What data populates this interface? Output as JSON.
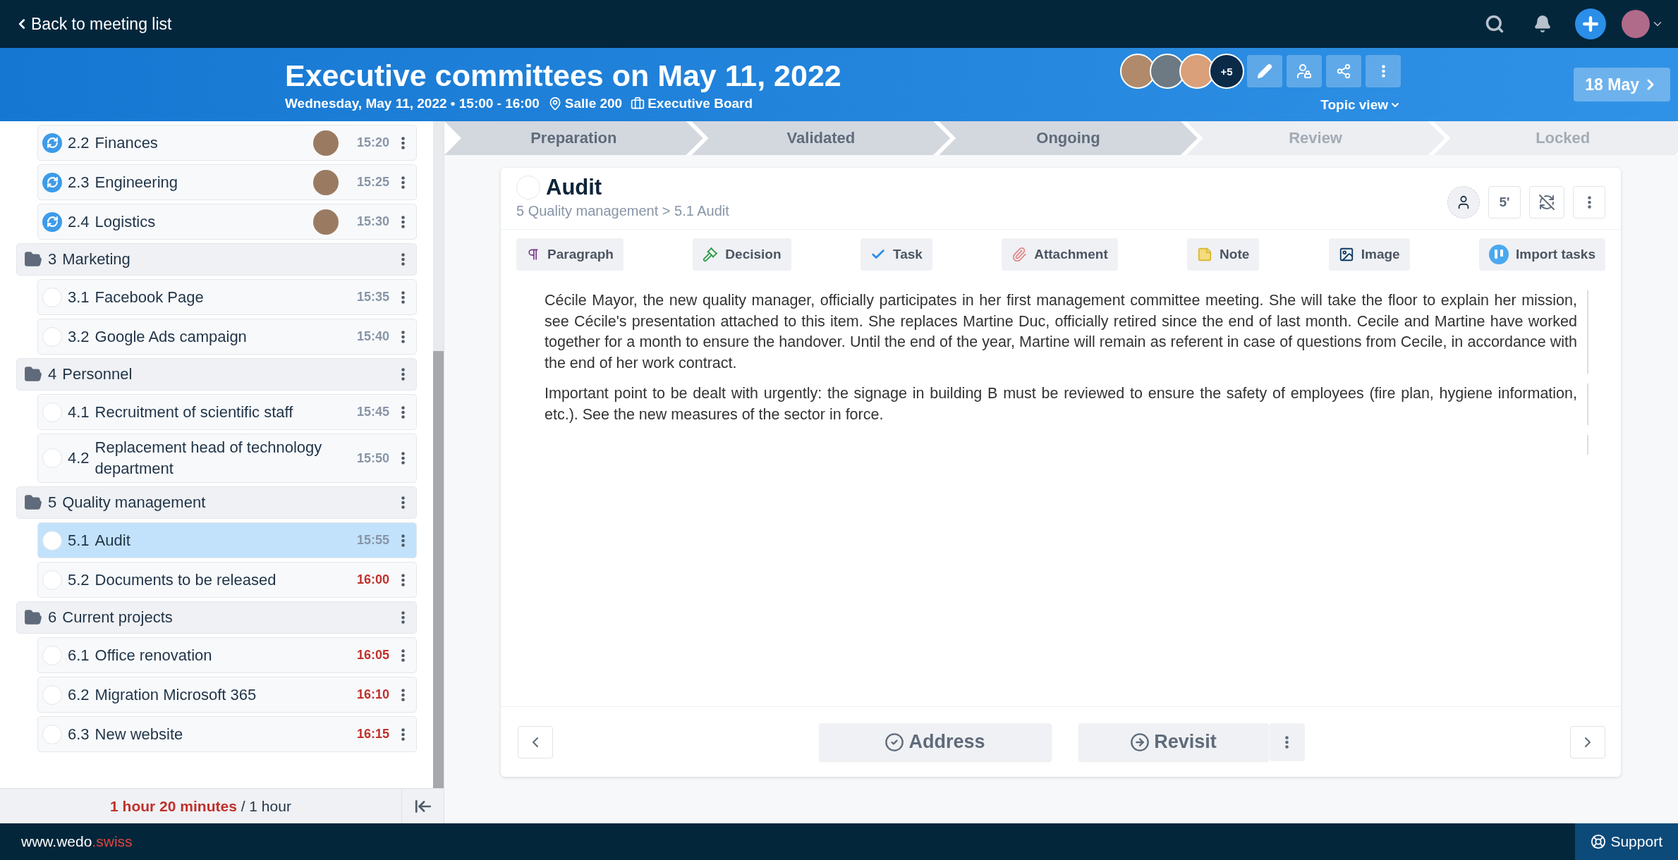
{
  "topbar": {
    "back_link": "Back to meeting list"
  },
  "meeting": {
    "title": "Executive committees on May 11, 2022",
    "schedule": "Wednesday, May 11, 2022 • 15:00 - 16:00",
    "location": "Salle 200",
    "board": "Executive Board",
    "extra_participants": "+5",
    "view_menu": "Topic view",
    "next_meeting": "18 May"
  },
  "agenda": [
    {
      "kind": "item",
      "number": "2.2",
      "title": "Finances",
      "time": "15:20",
      "recurring": true,
      "avatar": true,
      "overdue": false,
      "selected": false
    },
    {
      "kind": "item",
      "number": "2.3",
      "title": "Engineering",
      "time": "15:25",
      "recurring": true,
      "avatar": true,
      "overdue": false,
      "selected": false
    },
    {
      "kind": "item",
      "number": "2.4",
      "title": "Logistics",
      "time": "15:30",
      "recurring": true,
      "avatar": true,
      "overdue": false,
      "selected": false
    },
    {
      "kind": "section",
      "number": "3",
      "title": "Marketing"
    },
    {
      "kind": "item",
      "number": "3.1",
      "title": "Facebook Page",
      "time": "15:35",
      "recurring": false,
      "avatar": false,
      "overdue": false,
      "selected": false
    },
    {
      "kind": "item",
      "number": "3.2",
      "title": "Google Ads campaign",
      "time": "15:40",
      "recurring": false,
      "avatar": false,
      "overdue": false,
      "selected": false
    },
    {
      "kind": "section",
      "number": "4",
      "title": "Personnel"
    },
    {
      "kind": "item",
      "number": "4.1",
      "title": "Recruitment of scientific staff",
      "time": "15:45",
      "recurring": false,
      "avatar": false,
      "overdue": false,
      "selected": false
    },
    {
      "kind": "item",
      "number": "4.2",
      "title": "Replacement head of technology department",
      "time": "15:50",
      "recurring": false,
      "avatar": false,
      "overdue": false,
      "selected": false
    },
    {
      "kind": "section",
      "number": "5",
      "title": "Quality management"
    },
    {
      "kind": "item",
      "number": "5.1",
      "title": "Audit",
      "time": "15:55",
      "recurring": false,
      "avatar": false,
      "overdue": false,
      "selected": true
    },
    {
      "kind": "item",
      "number": "5.2",
      "title": "Documents to be released",
      "time": "16:00",
      "recurring": false,
      "avatar": false,
      "overdue": true,
      "selected": false
    },
    {
      "kind": "section",
      "number": "6",
      "title": "Current projects"
    },
    {
      "kind": "item",
      "number": "6.1",
      "title": "Office renovation",
      "time": "16:05",
      "recurring": false,
      "avatar": false,
      "overdue": true,
      "selected": false
    },
    {
      "kind": "item",
      "number": "6.2",
      "title": "Migration Microsoft 365",
      "time": "16:10",
      "recurring": false,
      "avatar": false,
      "overdue": true,
      "selected": false
    },
    {
      "kind": "item",
      "number": "6.3",
      "title": "New website",
      "time": "16:15",
      "recurring": false,
      "avatar": false,
      "overdue": true,
      "selected": false
    }
  ],
  "duration": {
    "actual": "1 hour 20 minutes",
    "planned": "/ 1 hour"
  },
  "stages": [
    {
      "label": "Preparation",
      "reached": true
    },
    {
      "label": "Validated",
      "reached": true
    },
    {
      "label": "Ongoing",
      "reached": true
    },
    {
      "label": "Review",
      "reached": false
    },
    {
      "label": "Locked",
      "reached": false
    }
  ],
  "topic": {
    "title": "Audit",
    "breadcrumb": "5 Quality management > 5.1 Audit",
    "duration": "5'",
    "done": false
  },
  "toolbar": [
    {
      "kind": "paragraph",
      "label": "Paragraph"
    },
    {
      "kind": "decision",
      "label": "Decision"
    },
    {
      "kind": "task",
      "label": "Task"
    },
    {
      "kind": "attachment",
      "label": "Attachment"
    },
    {
      "kind": "note",
      "label": "Note"
    },
    {
      "kind": "image",
      "label": "Image"
    },
    {
      "kind": "import",
      "label": "Import tasks"
    }
  ],
  "notes": [
    "Cécile Mayor, the new quality manager, officially participates in her first management committee meeting. She will take the floor to explain her mission, see Cécile's presentation attached to this item. She replaces Martine Duc, officially retired since the end of last month. Cecile and Martine have worked together for a month to ensure the handover. Until the end of the year, Martine will remain as referent in case of questions from Cecile, in accordance with the end of her work contract.",
    "Important point to be dealt with urgently: the signage in building B must be reviewed to ensure the safety of employees (fire plan, hygiene information, etc.). See the new measures of the sector in force."
  ],
  "actions": {
    "address": "Address",
    "revisit": "Revisit"
  },
  "footer": {
    "site": "www.wedo",
    "site_suffix": ".swiss",
    "support": "Support"
  }
}
